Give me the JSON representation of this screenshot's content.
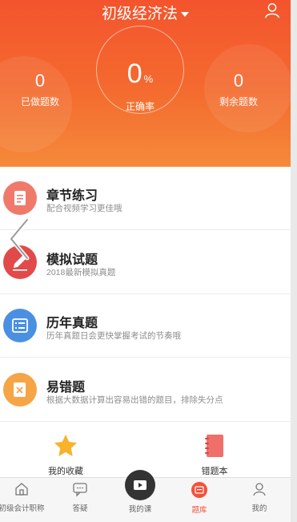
{
  "header": {
    "subject_title": "初级经济法",
    "stats": {
      "done": {
        "value": "0",
        "label": "已做题数"
      },
      "accuracy": {
        "value": "0",
        "unit": "%",
        "label": "正确率"
      },
      "remaining": {
        "value": "0",
        "label": "剩余题数"
      }
    }
  },
  "menu": [
    {
      "title": "章节练习",
      "subtitle": "配合视频学习更佳哦",
      "color": "#f07a6a"
    },
    {
      "title": "模拟试题",
      "subtitle": "2018最新模拟真题",
      "color": "#e24a4a"
    },
    {
      "title": "历年真题",
      "subtitle": "历年真题日会更快掌握考试的节奏哦",
      "color": "#4a90e2"
    },
    {
      "title": "易错题",
      "subtitle": "根据大数据计算出容易出错的题目，排除失分点",
      "color": "#f5a546"
    }
  ],
  "quick_actions": [
    {
      "label": "我的收藏",
      "icon": "star-icon",
      "color": "#f6b32b"
    },
    {
      "label": "错题本",
      "icon": "notebook-icon",
      "color": "#ef6f6a"
    }
  ],
  "tabbar": [
    {
      "label": "初级会计职称",
      "icon": "home-icon",
      "active": false
    },
    {
      "label": "答疑",
      "icon": "chat-icon",
      "active": false
    },
    {
      "label": "我的课",
      "icon": "play-icon",
      "active": false
    },
    {
      "label": "题库",
      "icon": "question-bank-icon",
      "active": true
    },
    {
      "label": "我的",
      "icon": "user-icon",
      "active": false
    }
  ],
  "colors": {
    "accent": "#f2513a",
    "header_top": "#f3542d",
    "header_bottom": "#f58a3a"
  }
}
